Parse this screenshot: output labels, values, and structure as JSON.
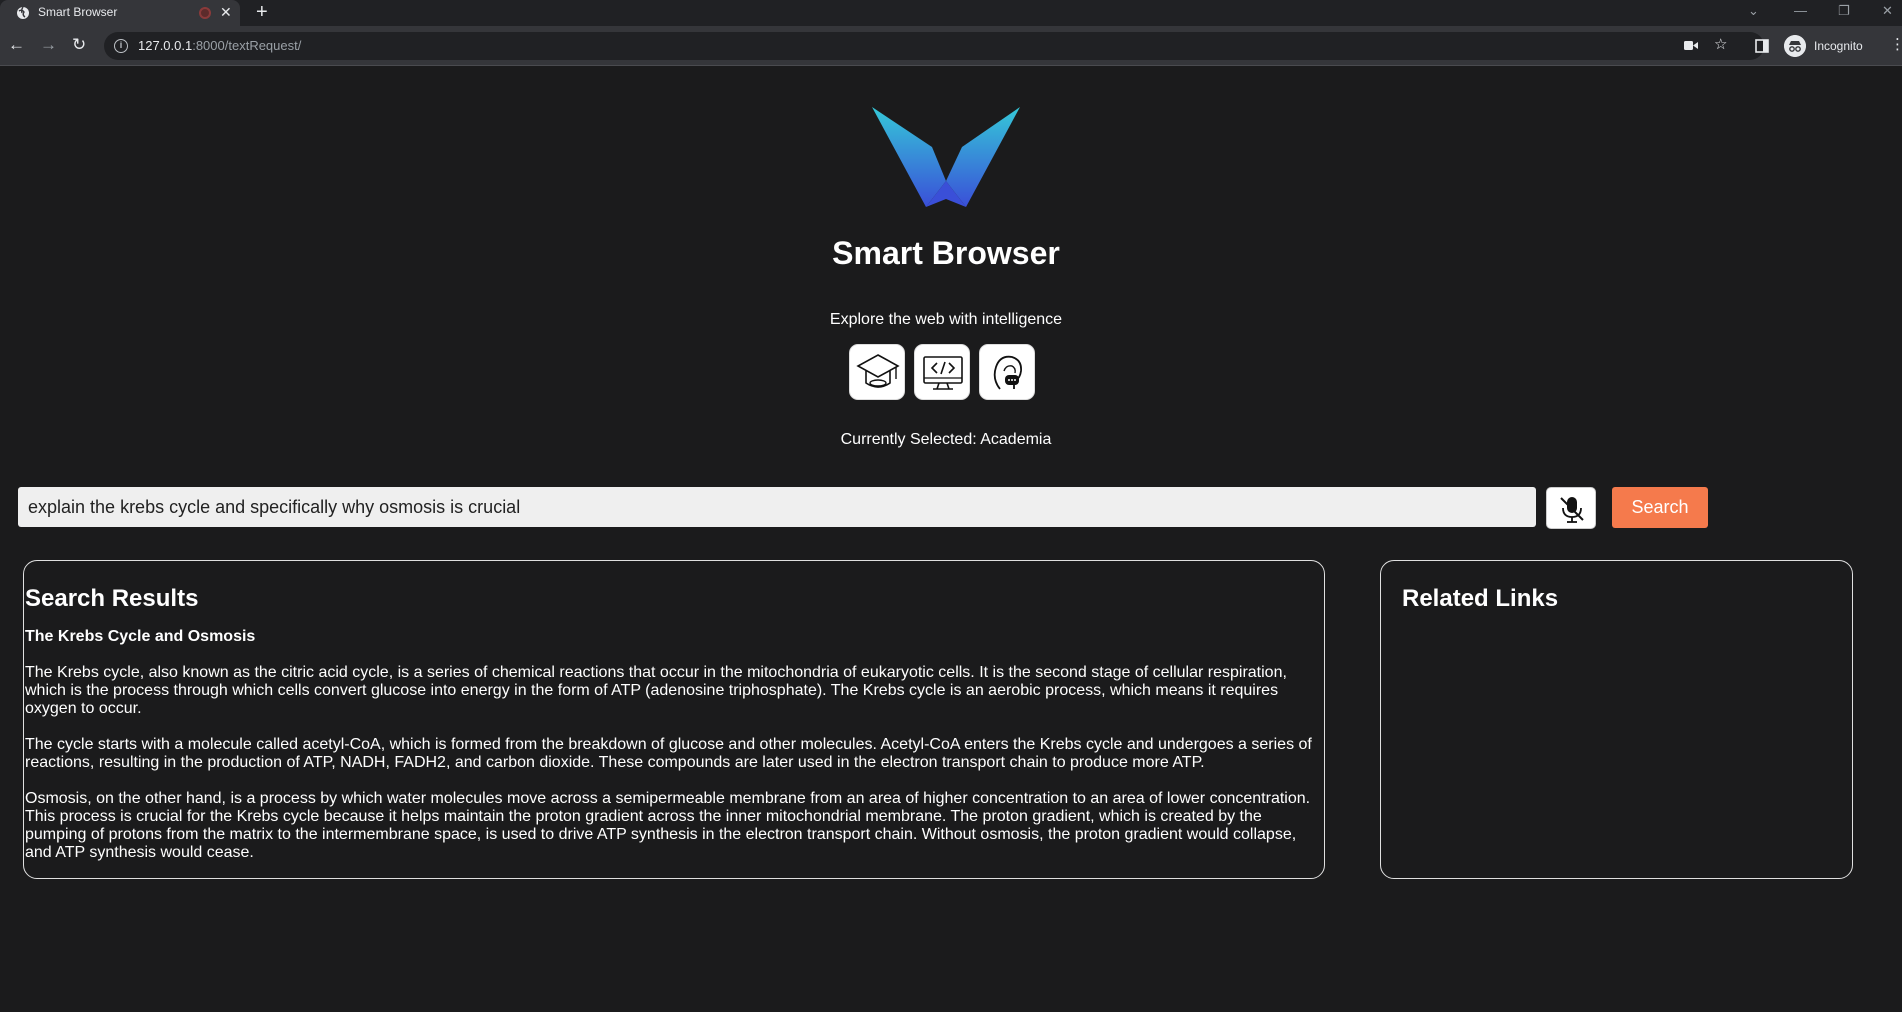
{
  "browser": {
    "tab_title": "Smart Browser",
    "tab_close": "✕",
    "new_tab": "+",
    "url_host": "127.0.0.1",
    "url_rest": ":8000/textRequest/",
    "profile_label": "Incognito",
    "icons": [
      "globe-icon",
      "audio-indicator-icon",
      "close-icon",
      "plus-icon",
      "back-icon",
      "forward-icon",
      "reload-icon",
      "info-icon",
      "camera-icon",
      "star-icon",
      "side-panel-icon",
      "incognito-icon",
      "menu-icon"
    ]
  },
  "app": {
    "title": "Smart Browser",
    "tagline": "Explore the web with intelligence",
    "modes": [
      {
        "name": "Academia",
        "icon": "graduation-cap-icon"
      },
      {
        "name": "Coding",
        "icon": "code-monitor-icon"
      },
      {
        "name": "Chat",
        "icon": "chat-head-icon"
      }
    ],
    "selected_label": "Currently Selected: Academia",
    "logo_gradient": [
      "#35c8d8",
      "#3a4fd8"
    ]
  },
  "search": {
    "value": "explain the krebs cycle and specifically why osmosis is crucial",
    "button_label": "Search",
    "button_color": "#f57a4c",
    "mic_icon": "mic-off-icon"
  },
  "results": {
    "heading": "Search Results",
    "title": "The Krebs Cycle and Osmosis",
    "paragraphs": [
      "The Krebs cycle, also known as the citric acid cycle, is a series of chemical reactions that occur in the mitochondria of eukaryotic cells. It is the second stage of cellular respiration, which is the process through which cells convert glucose into energy in the form of ATP (adenosine triphosphate). The Krebs cycle is an aerobic process, which means it requires oxygen to occur.",
      "The cycle starts with a molecule called acetyl-CoA, which is formed from the breakdown of glucose and other molecules. Acetyl-CoA enters the Krebs cycle and undergoes a series of reactions, resulting in the production of ATP, NADH, FADH2, and carbon dioxide. These compounds are later used in the electron transport chain to produce more ATP.",
      "Osmosis, on the other hand, is a process by which water molecules move across a semipermeable membrane from an area of higher concentration to an area of lower concentration. This process is crucial for the Krebs cycle because it helps maintain the proton gradient across the inner mitochondrial membrane. The proton gradient, which is created by the pumping of protons from the matrix to the intermembrane space, is used to drive ATP synthesis in the electron transport chain. Without osmosis, the proton gradient would collapse, and ATP synthesis would cease."
    ]
  },
  "related": {
    "heading": "Related Links"
  }
}
